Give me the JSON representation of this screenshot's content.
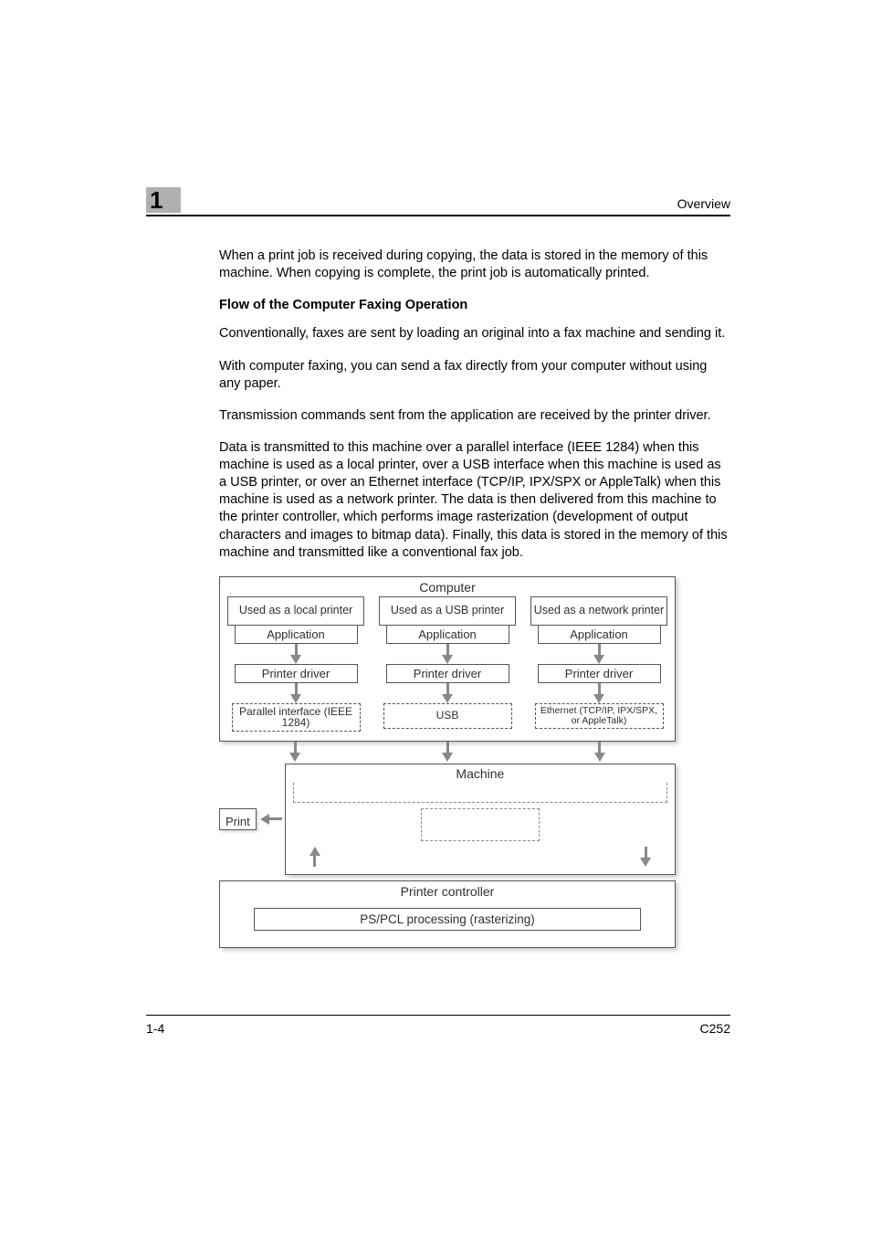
{
  "header": {
    "chapter_number": "1",
    "title": "Overview"
  },
  "paragraphs": {
    "intro": "When a print job is received during copying, the data is stored in the memory of this machine. When copying is complete, the print job is automatically printed.",
    "heading": "Flow of the Computer Faxing Operation",
    "p1": "Conventionally, faxes are sent by loading an original into a fax machine and sending it.",
    "p2": "With computer faxing, you can send a fax directly from your computer without using any paper.",
    "p3": "Transmission commands sent from the application are received by the printer driver.",
    "p4": "Data is transmitted to this machine over a parallel interface (IEEE 1284) when this machine is used as a local printer, over a USB interface when this machine is used as a USB printer, or over an Ethernet interface (TCP/IP, IPX/SPX or AppleTalk) when this machine is used as a network printer. The data is then delivered from this machine to the printer controller, which performs image rasterization (development of output characters and images to bitmap data). Finally, this data is stored in the memory of this machine and transmitted like a conventional fax job."
  },
  "diagram": {
    "computer_label": "Computer",
    "columns": [
      {
        "title": "Used as a local printer",
        "app": "Application",
        "driver": "Printer driver",
        "iface": "Parallel interface (IEEE 1284)"
      },
      {
        "title": "Used as a USB printer",
        "app": "Application",
        "driver": "Printer driver",
        "iface": "USB"
      },
      {
        "title": "Used as a network printer",
        "app": "Application",
        "driver": "Printer driver",
        "iface": "Ethernet (TCP/IP, IPX/SPX, or AppleTalk)"
      }
    ],
    "print_label": "Print",
    "machine_label": "Machine",
    "controller_label": "Printer controller",
    "controller_inner": "PS/PCL processing (rasterizing)"
  },
  "footer": {
    "page": "1-4",
    "model": "C252"
  }
}
